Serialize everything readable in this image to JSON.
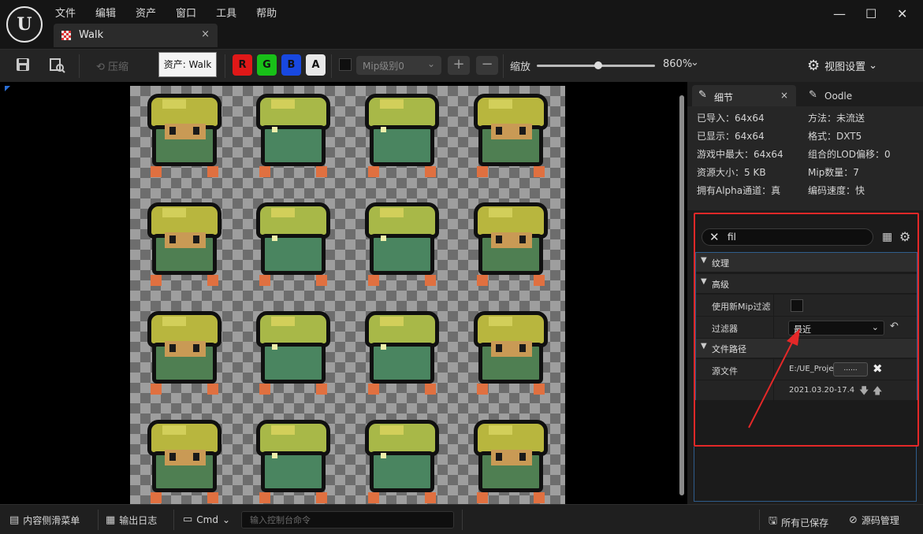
{
  "app": {
    "logo_text": "U",
    "menu": [
      "文件",
      "编辑",
      "资产",
      "窗口",
      "工具",
      "帮助"
    ],
    "tab": {
      "title": "Walk",
      "close": "×"
    },
    "window_controls": {
      "minimize": "—",
      "maximize": "☐",
      "close": "✕"
    }
  },
  "toolbar": {
    "compress_label": "压缩",
    "tooltip": "资产: Walk",
    "channels": [
      {
        "label": "R",
        "color": "#e01818",
        "text_color": "#111111"
      },
      {
        "label": "G",
        "color": "#18c018",
        "text_color": "#111111"
      },
      {
        "label": "B",
        "color": "#1848e0",
        "text_color": "#111111"
      },
      {
        "label": "A",
        "color": "#e8e8e8",
        "text_color": "#111111"
      }
    ],
    "mip_select": "Mip级别0",
    "plus": "+",
    "minus": "−",
    "zoom_label": "缩放",
    "zoom_slider_fraction": 0.52,
    "zoom_value": "860%",
    "view_settings": "视图设置"
  },
  "viewport": {
    "texture_name": "Walk",
    "scroll_fraction": 1.0,
    "sprite_grid": {
      "rows": 4,
      "cols": 4
    }
  },
  "details_panel": {
    "tabs": [
      {
        "label": "细节",
        "close": "×"
      },
      {
        "label": "Oodle"
      }
    ],
    "info": [
      [
        "已导入：64x64",
        "方法：未流送"
      ],
      [
        "已显示：64x64",
        "格式：DXT5"
      ],
      [
        "游戏中最大：64x64",
        "组合的LOD偏移：0"
      ],
      [
        "资源大小：5 KB",
        "Mip数量：7"
      ],
      [
        "拥有Alpha通道：真",
        "编码速度：快"
      ]
    ],
    "search_value": "fil",
    "categories": {
      "texture": "纹理",
      "advanced": "高级",
      "file_path": "文件路径"
    },
    "properties": {
      "use_new_mip_filter": {
        "label": "使用新Mip过滤",
        "checked": false
      },
      "filter": {
        "label": "过滤器",
        "value": "最近"
      },
      "source_file": {
        "label": "源文件",
        "path": "E:/UE_Proje",
        "browse": "......",
        "clear": "✖"
      },
      "source_date": "2021.03.20-17.4"
    },
    "highlight_color": "#e42828"
  },
  "bottom_bar": {
    "content_drawer": "内容侧滑菜单",
    "output_log": "输出日志",
    "cmd": "Cmd",
    "console_placeholder": "输入控制台命令",
    "all_saved": "所有已保存",
    "source_control": "源码管理"
  }
}
